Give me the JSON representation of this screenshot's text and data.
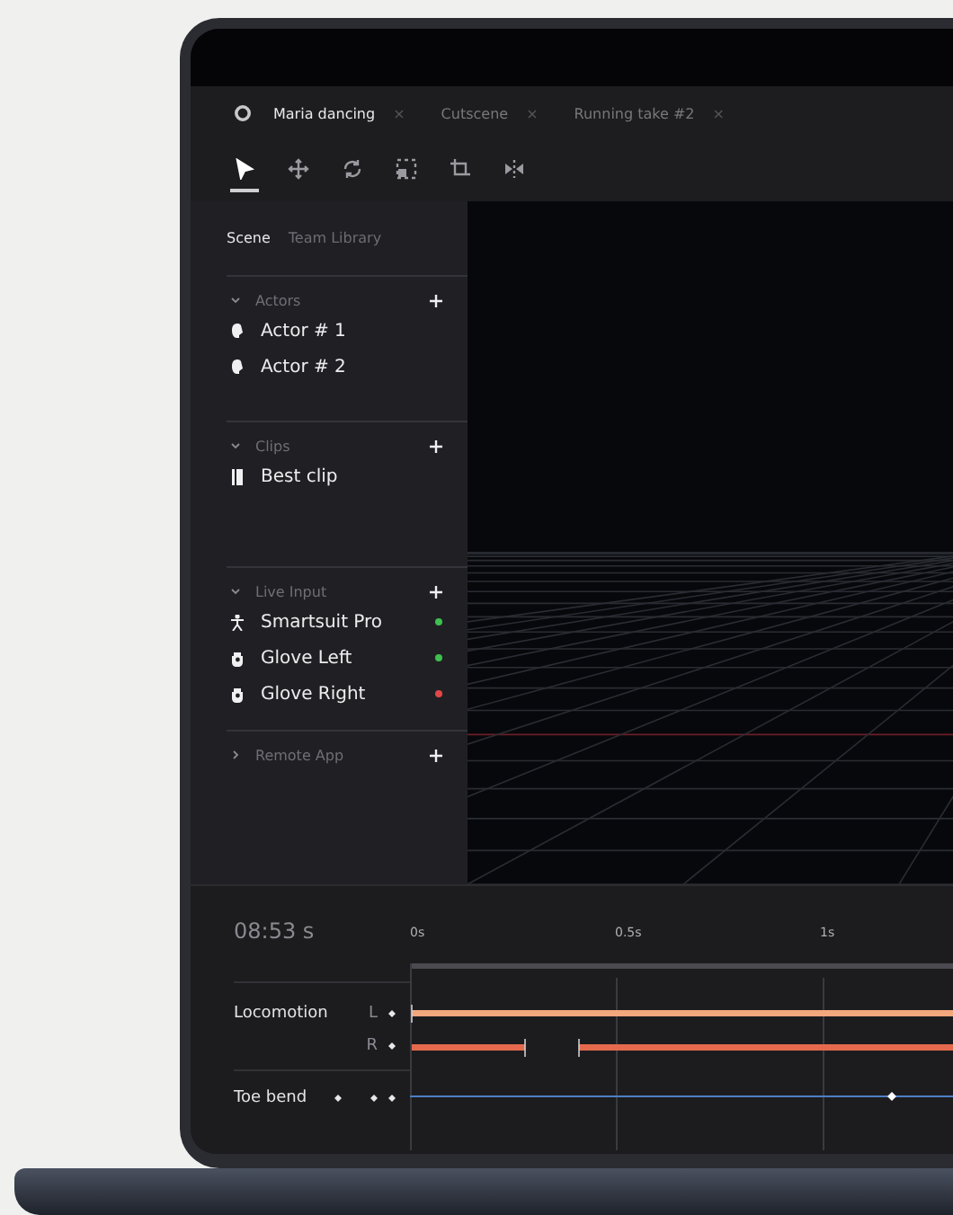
{
  "tabs": [
    {
      "label": "Maria dancing",
      "close": "×",
      "selected": true
    },
    {
      "label": "Cutscene",
      "close": "×",
      "selected": false
    },
    {
      "label": "Running take #2",
      "close": "×",
      "selected": false
    }
  ],
  "tools": [
    {
      "kind": "pointer",
      "selected": true
    },
    {
      "kind": "move",
      "selected": false
    },
    {
      "kind": "rotate",
      "selected": false
    },
    {
      "kind": "scale",
      "selected": false
    },
    {
      "kind": "crop",
      "selected": false
    },
    {
      "kind": "mirror",
      "selected": false
    }
  ],
  "sidebar": {
    "tabs": [
      {
        "label": "Scene",
        "selected": true
      },
      {
        "label": "Team Library",
        "selected": false
      }
    ],
    "sections": [
      {
        "title": "Actors",
        "expanded": true,
        "items": [
          {
            "kind": "head",
            "label": "Actor # 1"
          },
          {
            "kind": "head",
            "label": "Actor # 2"
          }
        ]
      },
      {
        "title": "Clips",
        "expanded": true,
        "items": [
          {
            "kind": "clip",
            "label": "Best clip"
          }
        ]
      },
      {
        "title": "Live Input",
        "expanded": true,
        "items": [
          {
            "kind": "suit",
            "label": "Smartsuit Pro",
            "color": "#3fbf4f"
          },
          {
            "kind": "glove",
            "label": "Glove Left",
            "color": "#3fbf4f"
          },
          {
            "kind": "glove",
            "label": "Glove Right",
            "color": "#e04848"
          }
        ]
      },
      {
        "title": "Remote App",
        "expanded": false
      }
    ]
  },
  "timeline": {
    "time": "08:53 s",
    "ticks": [
      "0s",
      "0.5s",
      "1s"
    ],
    "tracks": [
      {
        "label": "Locomotion",
        "channels": [
          "L",
          "R"
        ]
      },
      {
        "label": "Toe bend"
      }
    ]
  }
}
